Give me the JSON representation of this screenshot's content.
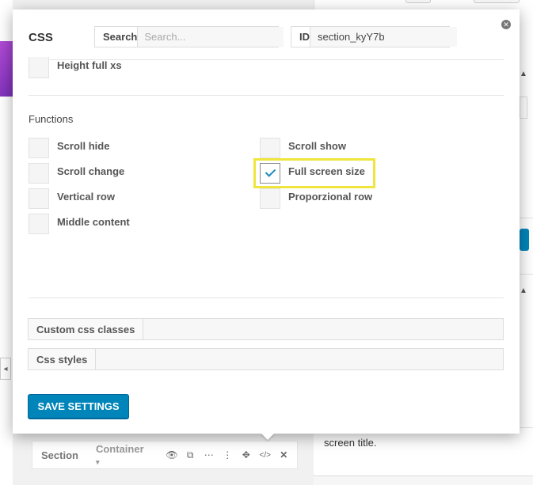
{
  "modal": {
    "title": "CSS",
    "search": {
      "label": "Search",
      "placeholder": "Search..."
    },
    "id": {
      "label": "ID",
      "value": "section_kyY7b"
    },
    "top_item": {
      "label": "Height full xs",
      "checked": false
    },
    "functions_heading": "Functions",
    "functions_left": [
      {
        "label": "Scroll hide",
        "checked": false
      },
      {
        "label": "Scroll change",
        "checked": false
      },
      {
        "label": "Vertical row",
        "checked": false
      },
      {
        "label": "Middle content",
        "checked": false
      }
    ],
    "functions_right": [
      {
        "label": "Scroll show",
        "checked": false
      },
      {
        "label": "Full screen size",
        "checked": true
      },
      {
        "label": "Proporzional row",
        "checked": false
      }
    ],
    "custom_css_classes": {
      "label": "Custom css classes",
      "value": ""
    },
    "css_styles": {
      "label": "Css styles",
      "value": ""
    },
    "save_label": "SAVE SETTINGS"
  },
  "toolbar": {
    "section_label": "Section",
    "container_label": "Container",
    "icons": [
      "eye-icon",
      "duplicate-icon",
      "more-horizontal-icon",
      "more-vertical-icon",
      "move-icon",
      "code-icon",
      "close-icon"
    ]
  },
  "background": {
    "screen_title_text": "screen title."
  },
  "colors": {
    "accent": "#0085ba",
    "highlight": "#f0e53c",
    "check": "#1e8cbe"
  }
}
